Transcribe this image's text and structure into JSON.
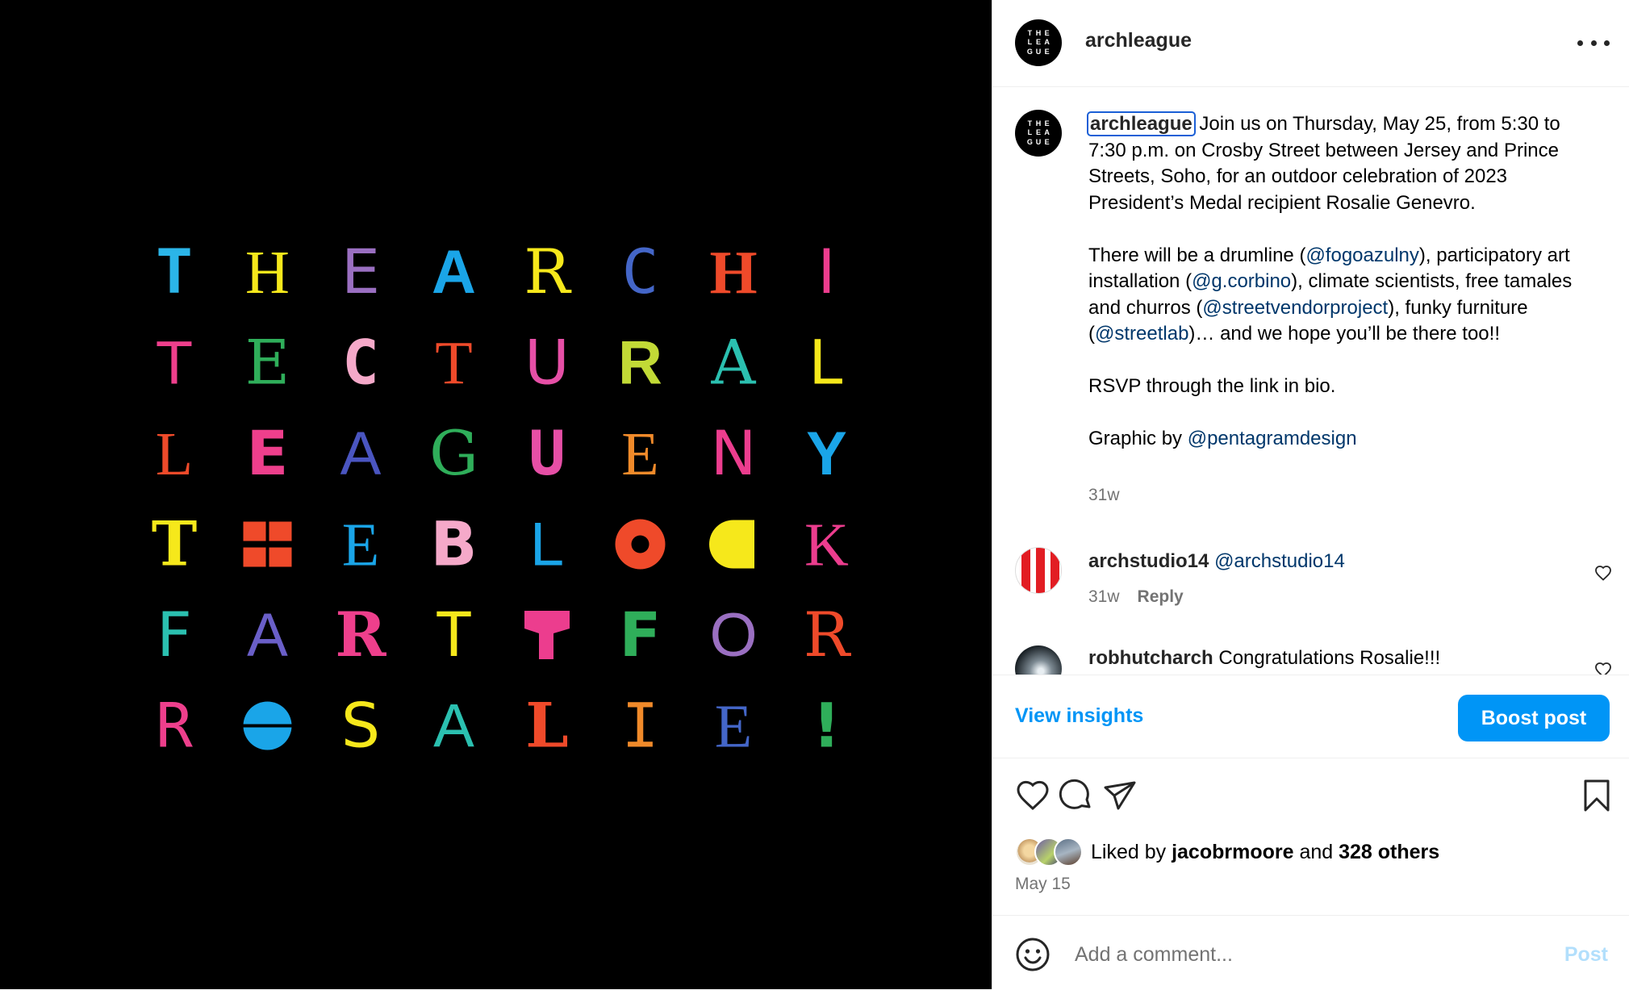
{
  "media": {
    "alt_letters": [
      [
        "T",
        "H",
        "E",
        "A",
        "R",
        "C",
        "H",
        "I"
      ],
      [
        "T",
        "E",
        "C",
        "T",
        "U",
        "R",
        "A",
        "L"
      ],
      [
        "L",
        "E",
        "A",
        "G",
        "U",
        "E",
        "N",
        "Y"
      ],
      [
        "T",
        "",
        "E",
        "B",
        "L",
        "",
        "",
        "K"
      ],
      [
        "F",
        "A",
        "R",
        "T",
        "",
        "F",
        "O",
        "R"
      ],
      [
        "R",
        "",
        "S",
        "A",
        "L",
        "I",
        "E",
        "!"
      ]
    ],
    "colors": [
      [
        "#2bb5e8",
        "#f6e81b",
        "#9a6fc1",
        "#1aa5e8",
        "#f6e81b",
        "#4466c8",
        "#ef4a2a",
        "#ec3d8e"
      ],
      [
        "#ee3f8c",
        "#2fae5a",
        "#f5a9c9",
        "#ef4a2a",
        "#e64fa6",
        "#c2da36",
        "#2bc0b0",
        "#f6e81b"
      ],
      [
        "#ef4a2a",
        "#ee3f8c",
        "#4a55c0",
        "#2fae5a",
        "#e64fa6",
        "#f08a2a",
        "#ec3d8e",
        "#1aa5e8"
      ],
      [
        "#f6e81b",
        "#ef4a2a",
        "#1aa5e8",
        "#f5a9c9",
        "#1aa5e8",
        "#ef4a2a",
        "#f6e81b",
        "#ec3d8e"
      ],
      [
        "#2bc0b0",
        "#6a5fc8",
        "#ee3f8c",
        "#f6e81b",
        "#ec3d8e",
        "#2fae5a",
        "#9a6fc1",
        "#ef4a2a"
      ],
      [
        "#ee3f8c",
        "#1aa5e8",
        "#f6e81b",
        "#2bc0b0",
        "#ef4a2a",
        "#f08a2a",
        "#4466c8",
        "#2fae5a"
      ]
    ]
  },
  "header": {
    "username": "archleague",
    "avatar_letters": [
      "T",
      "H",
      "E",
      "L",
      "E",
      "A",
      "G",
      "U",
      "E"
    ]
  },
  "caption": {
    "username": "archleague",
    "segments": [
      {
        "t": "text",
        "v": " Join us on Thursday, May 25, from 5:30 to 7:30 p.m. on Crosby Street between Jersey and Prince Streets, Soho, for an outdoor celebration of 2023 President’s Medal recipient Rosalie Genevro.\n\nThere will be a drumline ("
      },
      {
        "t": "mention",
        "v": "@fogoazulny"
      },
      {
        "t": "text",
        "v": "), participatory art installation ("
      },
      {
        "t": "mention",
        "v": "@g.corbino"
      },
      {
        "t": "text",
        "v": "), climate scientists, free tamales and churros ("
      },
      {
        "t": "mention",
        "v": "@streetvendorproject"
      },
      {
        "t": "text",
        "v": "), funky furniture ("
      },
      {
        "t": "mention",
        "v": "@streetlab"
      },
      {
        "t": "text",
        "v": ")… and we hope you’ll be there too!!\n\nRSVP through the link in bio.\n\nGraphic by "
      },
      {
        "t": "mention",
        "v": "@pentagramdesign"
      }
    ],
    "time": "31w"
  },
  "comments": [
    {
      "username": "archstudio14",
      "mention": "@archstudio14",
      "text": "",
      "time": "31w",
      "reply": "Reply"
    },
    {
      "username": "robhutcharch",
      "mention": "",
      "text": " Congratulations Rosalie!!!",
      "time": "",
      "reply": ""
    }
  ],
  "insights": {
    "view_label": "View insights",
    "boost_label": "Boost post"
  },
  "likes": {
    "prefix": "Liked by ",
    "user": "jacobrmoore",
    "middle": " and ",
    "others": "328 others"
  },
  "date": "May 15",
  "comment_box": {
    "placeholder": "Add a comment...",
    "post_label": "Post"
  },
  "icons": [
    "heart-icon",
    "comment-icon",
    "share-icon",
    "bookmark-icon",
    "emoji-icon",
    "more-icon"
  ]
}
